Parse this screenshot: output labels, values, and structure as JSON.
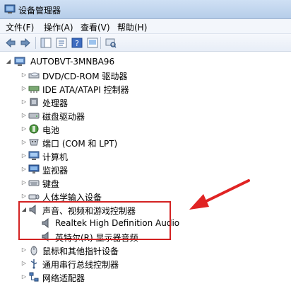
{
  "window": {
    "title": "设备管理器"
  },
  "menu": [
    "文件(F)",
    "操作(A)",
    "查看(V)",
    "帮助(H)"
  ],
  "tree": {
    "root": "AUTOBVT-3MNBA96",
    "items": [
      {
        "label": "DVD/CD-ROM 驱动器",
        "icon": "optical-drive-icon"
      },
      {
        "label": "IDE ATA/ATAPI 控制器",
        "icon": "ide-controller-icon"
      },
      {
        "label": "处理器",
        "icon": "processor-icon"
      },
      {
        "label": "磁盘驱动器",
        "icon": "disk-drive-icon"
      },
      {
        "label": "电池",
        "icon": "battery-icon"
      },
      {
        "label": "端口 (COM 和 LPT)",
        "icon": "port-icon"
      },
      {
        "label": "计算机",
        "icon": "computer-icon"
      },
      {
        "label": "监视器",
        "icon": "monitor-icon"
      },
      {
        "label": "键盘",
        "icon": "keyboard-icon"
      },
      {
        "label": "人体学输入设备",
        "icon": "hid-icon"
      },
      {
        "label": "声音、视频和游戏控制器",
        "icon": "speaker-icon",
        "expanded": true,
        "children": [
          {
            "label": "Realtek High Definition Audio",
            "icon": "speaker-icon"
          },
          {
            "label": "英特尔(R) 显示器音频",
            "icon": "speaker-icon"
          }
        ]
      },
      {
        "label": "鼠标和其他指针设备",
        "icon": "mouse-icon"
      },
      {
        "label": "通用串行总线控制器",
        "icon": "usb-icon"
      },
      {
        "label": "网络适配器",
        "icon": "network-icon"
      }
    ]
  },
  "colors": {
    "highlight": "#d32222"
  }
}
